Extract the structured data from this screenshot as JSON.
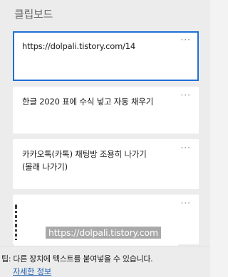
{
  "panel": {
    "title": "클립보드"
  },
  "items": [
    {
      "text": "https://dolpali.tistory.com/14",
      "more": "···"
    },
    {
      "text": "한글 2020 표에 수식 넣고 자동 채우기",
      "more": "···"
    },
    {
      "text": "카카오톡(카톡) 채팅방 조용히 나가기\n(몰래 나가기)",
      "more": "···"
    },
    {
      "image_watermark": "https://dolpali.tistory.com",
      "more": "···"
    }
  ],
  "footer": {
    "tip": "팁: 다른 장치에 텍스트를 붙여넣을 수 있습니다.",
    "link": "자세한 정보"
  },
  "colors": {
    "selected_border": "#1f6fd6",
    "link": "#1d5fb0"
  }
}
